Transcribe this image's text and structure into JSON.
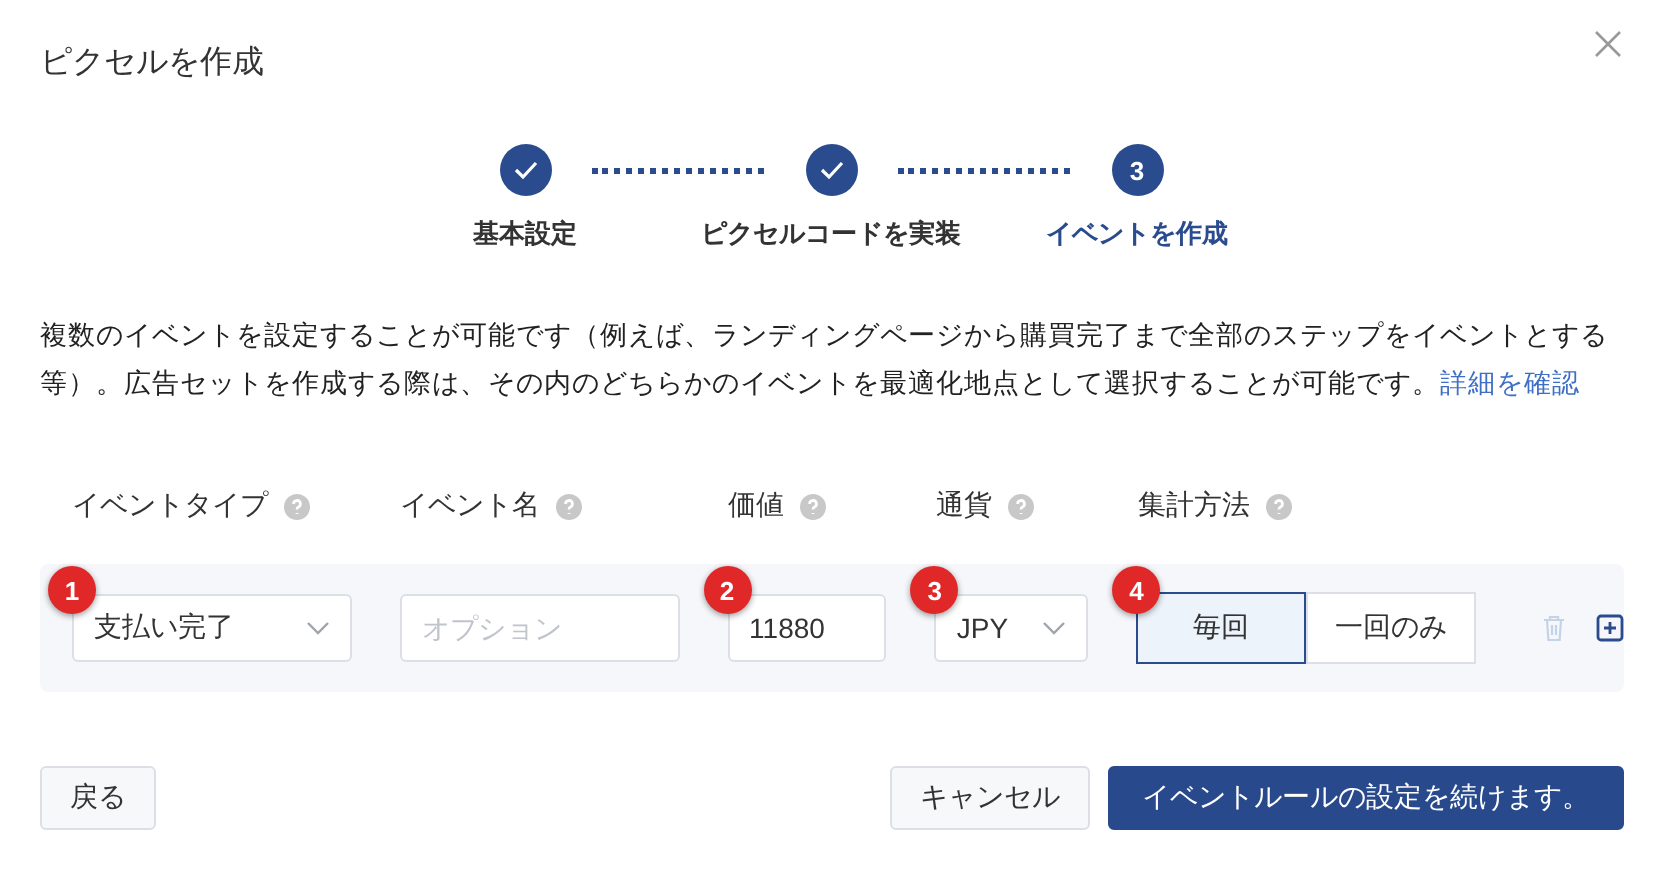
{
  "window": {
    "title": "ピクセルを作成"
  },
  "steps": [
    {
      "label": "基本設定",
      "completed": true,
      "selected": false
    },
    {
      "label": "ピクセルコードを実装",
      "completed": true,
      "selected": false
    },
    {
      "label": "イベントを作成",
      "completed": false,
      "selected": true,
      "number": "3"
    }
  ],
  "description": {
    "text": "複数のイベントを設定することが可能です（例えば、ランディングページから購買完了まで全部のステップをイベントとする等）。広告セットを作成する際は、その内のどちらかのイベントを最適化地点として選択することが可能です。",
    "link": "詳細を確認"
  },
  "columns": [
    {
      "label": "イベントタイプ"
    },
    {
      "label": "イベント名"
    },
    {
      "label": "価値"
    },
    {
      "label": "通貨"
    },
    {
      "label": "集計方法"
    }
  ],
  "row": {
    "fields": [
      {
        "kind": "select",
        "value": "支払い完了",
        "marker": "1"
      },
      {
        "kind": "input",
        "placeholder": "オプション"
      },
      {
        "kind": "input",
        "value": "11880",
        "marker": "2"
      },
      {
        "kind": "select",
        "value": "JPY",
        "marker": "3"
      },
      {
        "kind": "segmented",
        "marker": "4",
        "options": [
          {
            "label": "毎回",
            "selected": true
          },
          {
            "label": "一回のみ",
            "selected": false
          }
        ]
      }
    ]
  },
  "buttons": {
    "back": "戻る",
    "cancel": "キャンセル",
    "continue": "イベントルールの設定を続けます。"
  }
}
